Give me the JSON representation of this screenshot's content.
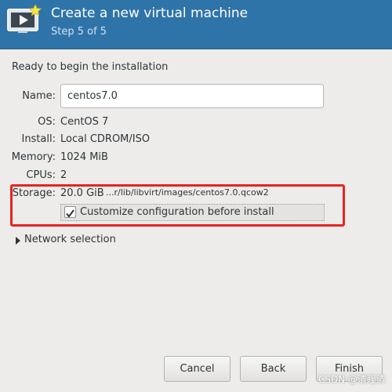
{
  "header": {
    "title": "Create a new virtual machine",
    "step": "Step 5 of 5",
    "icon": "new-vm-monitor-icon",
    "background_color": "#2f74a8"
  },
  "summary": {
    "intro": "Ready to begin the installation",
    "name_label": "Name:",
    "name_value": "centos7.0",
    "os_label": "OS:",
    "os_value": "CentOS 7",
    "install_label": "Install:",
    "install_value": "Local CDROM/ISO",
    "memory_label": "Memory:",
    "memory_value": "1024 MiB",
    "cpus_label": "CPUs:",
    "cpus_value": "2",
    "storage_label": "Storage:",
    "storage_size": "20.0 GiB",
    "storage_path": "...r/lib/libvirt/images/centos7.0.qcow2"
  },
  "customize": {
    "label": "Customize configuration before install",
    "checked": true
  },
  "network": {
    "label": "Network selection",
    "expanded": false
  },
  "buttons": {
    "cancel": "Cancel",
    "back": "Back",
    "finish": "Finish"
  },
  "annotation": {
    "highlight_color": "#e8231d"
  },
  "watermark": "CSDN @清瞳清"
}
